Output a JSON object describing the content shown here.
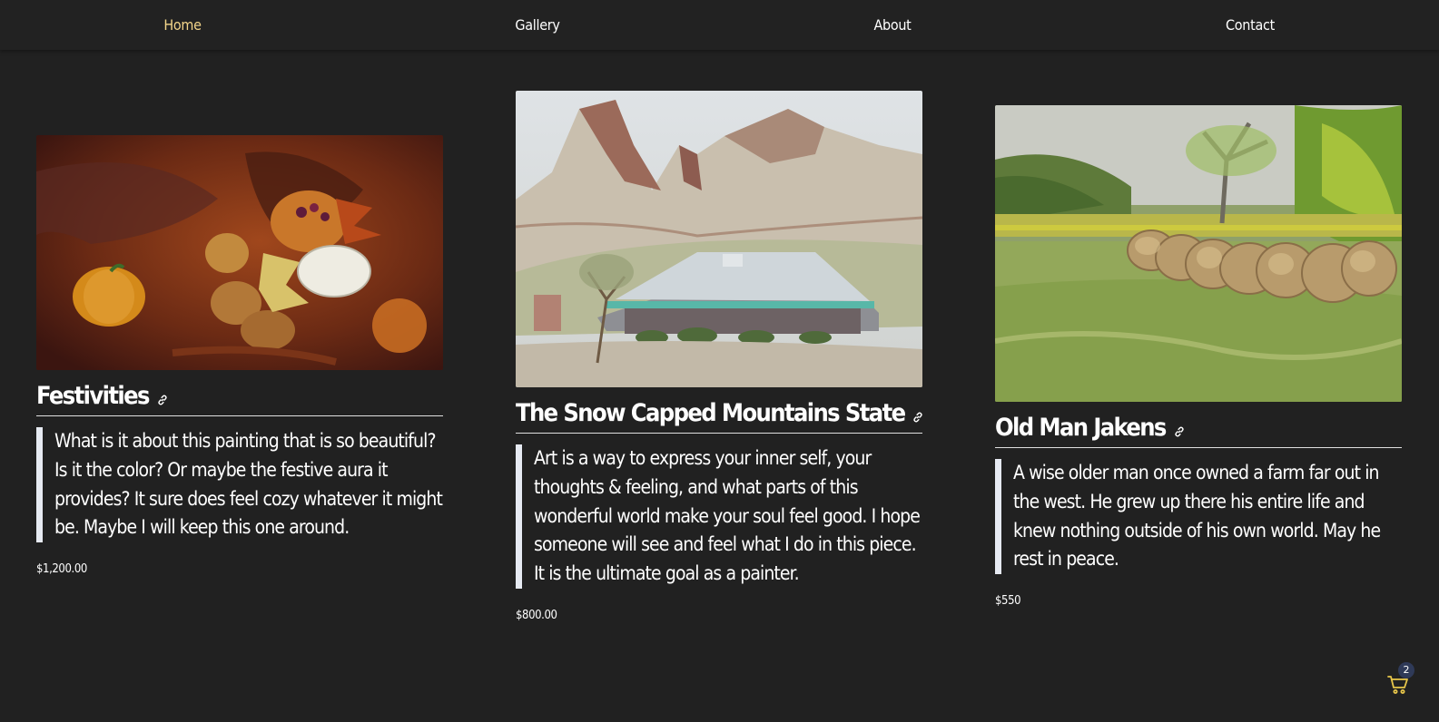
{
  "nav": {
    "items": [
      {
        "label": "Home",
        "active": true
      },
      {
        "label": "Gallery",
        "active": false
      },
      {
        "label": "About",
        "active": false
      },
      {
        "label": "Contact",
        "active": false
      }
    ]
  },
  "artworks": [
    {
      "title": "Festivities",
      "description": "What is it about this painting that is so beautiful? Is it the color? Or maybe the festive aura it provides? It sure does feel cozy whatever it might be. Maybe I will keep this one around.",
      "price": "$1,200.00"
    },
    {
      "title": "The Snow Capped Mountains State",
      "description": "Art is a way to express your inner self, your thoughts & feeling, and what parts of this wonderful world make your soul feel good. I hope someone will see and feel what I do in this piece. It is the ultimate goal as a painter.",
      "price": "$800.00"
    },
    {
      "title": "Old Man Jakens",
      "description": "A wise older man once owned a farm far out in the west. He grew up there his entire life and knew nothing outside of his own world. May he rest in peace.",
      "price": "$550"
    }
  ],
  "cart": {
    "count": "2",
    "icon": "cart-icon"
  },
  "colors": {
    "background": "#212121",
    "nav_active": "#f3d58a",
    "cart_icon": "#e8c64a",
    "badge": "#2f3a58"
  }
}
